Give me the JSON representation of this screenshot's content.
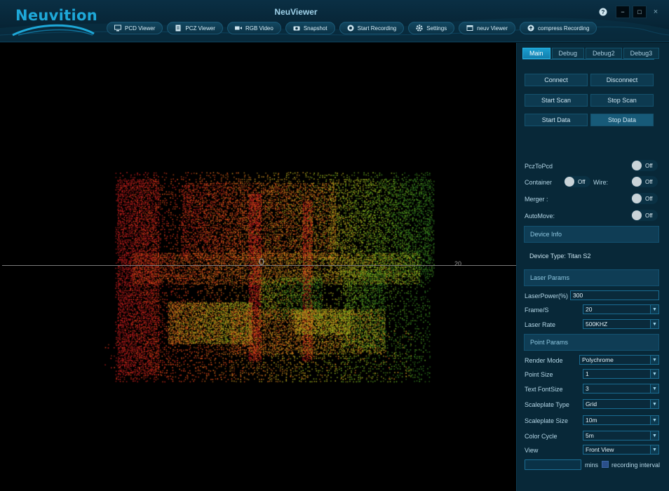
{
  "app": {
    "logo_text": "Neuvition",
    "title": "NeuViewer",
    "window_controls": {
      "help": "?",
      "minimize": "−",
      "maximize": "□",
      "close": "×"
    }
  },
  "nav": [
    {
      "label": "PCD Viewer",
      "icon": "monitor-icon"
    },
    {
      "label": "PCZ Viewer",
      "icon": "document-icon"
    },
    {
      "label": "RGB Video",
      "icon": "video-camera-icon"
    },
    {
      "label": "Snapshot",
      "icon": "camera-icon"
    },
    {
      "label": "Start Recording",
      "icon": "record-icon"
    },
    {
      "label": "Settings",
      "icon": "gear-icon"
    },
    {
      "label": "neuv Viewer",
      "icon": "window-icon"
    },
    {
      "label": "compress Recording",
      "icon": "compress-icon"
    }
  ],
  "viewer": {
    "axis_origin_label": "0",
    "axis_tick_label": "20"
  },
  "tabs": [
    {
      "label": "Main",
      "active": true
    },
    {
      "label": "Debug",
      "active": false
    },
    {
      "label": "Debug2",
      "active": false
    },
    {
      "label": "Debug3",
      "active": false
    }
  ],
  "controls": {
    "connect": "Connect",
    "disconnect": "Disconnect",
    "start_scan": "Start Scan",
    "stop_scan": "Stop Scan",
    "start_data": "Start Data",
    "stop_data": "Stop Data"
  },
  "toggles": {
    "pcz_to_pcd": {
      "label": "PczToPcd",
      "state": "Off"
    },
    "container": {
      "label": "Container",
      "state": "Off"
    },
    "wire": {
      "label": "Wire:",
      "state": "Off"
    },
    "merger": {
      "label": "Merger :",
      "state": "Off"
    },
    "automove": {
      "label": "AutoMove:",
      "state": "Off"
    }
  },
  "device_info": {
    "header": "Device Info",
    "device_type": "Device Type: Titan S2"
  },
  "laser_params": {
    "header": "Laser Params",
    "laser_power_label": "LaserPower(%)",
    "laser_power_value": "300",
    "frame_label": "Frame/S",
    "frame_value": "20",
    "laser_rate_label": "Laser Rate",
    "laser_rate_value": "500KHZ"
  },
  "point_params": {
    "header": "Point Params",
    "render_mode_label": "Render Mode",
    "render_mode_value": "Polychrome",
    "point_size_label": "Point Size",
    "point_size_value": "1",
    "text_fontsize_label": "Text FontSize",
    "text_fontsize_value": "3",
    "scaleplate_type_label": "Scaleplate Type",
    "scaleplate_type_value": "Grid",
    "scaleplate_size_label": "Scaleplate Size",
    "scaleplate_size_value": "10m",
    "color_cycle_label": "Color Cycle",
    "color_cycle_value": "5m",
    "view_label": "View",
    "view_value": "Front View"
  },
  "recording": {
    "interval_value": "",
    "mins_label": "mins",
    "interval_label": "recording interval"
  },
  "colors": {
    "accent": "#1ea8d8",
    "panel_bg": "#082838",
    "header_bg": "#072536"
  }
}
